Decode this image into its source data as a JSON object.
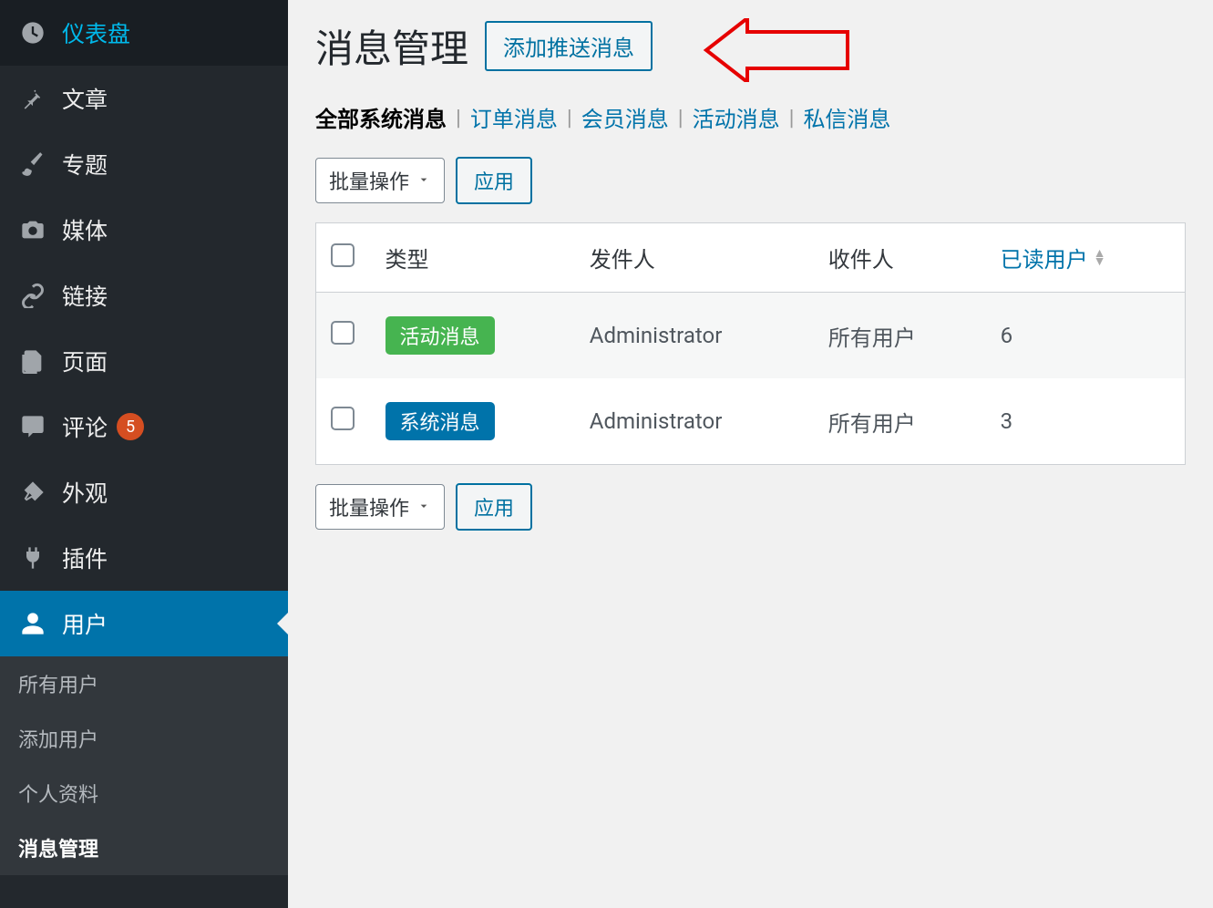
{
  "sidebar": {
    "items": [
      {
        "label": "仪表盘",
        "icon": "dashboard"
      },
      {
        "label": "文章",
        "icon": "pin"
      },
      {
        "label": "专题",
        "icon": "brush"
      },
      {
        "label": "媒体",
        "icon": "camera"
      },
      {
        "label": "链接",
        "icon": "link"
      },
      {
        "label": "页面",
        "icon": "pages"
      },
      {
        "label": "评论",
        "icon": "comment",
        "badge": "5"
      },
      {
        "label": "外观",
        "icon": "brush2"
      },
      {
        "label": "插件",
        "icon": "plug"
      },
      {
        "label": "用户",
        "icon": "user",
        "active": true
      }
    ],
    "submenu": [
      {
        "label": "所有用户"
      },
      {
        "label": "添加用户"
      },
      {
        "label": "个人资料"
      },
      {
        "label": "消息管理",
        "current": true
      }
    ]
  },
  "page": {
    "title": "消息管理",
    "add_button": "添加推送消息"
  },
  "tabs": [
    {
      "label": "全部系统消息",
      "active": true
    },
    {
      "label": "订单消息"
    },
    {
      "label": "会员消息"
    },
    {
      "label": "活动消息"
    },
    {
      "label": "私信消息"
    }
  ],
  "bulk": {
    "select_label": "批量操作",
    "apply_label": "应用"
  },
  "table": {
    "headers": {
      "type": "类型",
      "sender": "发件人",
      "recipient": "收件人",
      "read": "已读用户"
    },
    "rows": [
      {
        "type": "活动消息",
        "type_color": "green",
        "sender": "Administrator",
        "recipient": "所有用户",
        "read": "6"
      },
      {
        "type": "系统消息",
        "type_color": "blue",
        "sender": "Administrator",
        "recipient": "所有用户",
        "read": "3"
      }
    ]
  }
}
